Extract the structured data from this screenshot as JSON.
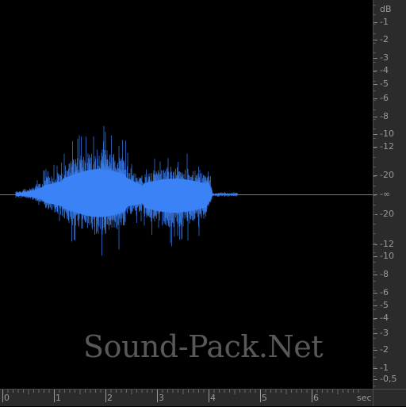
{
  "waveform": {
    "color": "#3b82f6",
    "background": "#000000"
  },
  "db_scale": {
    "unit": "dB",
    "labels": [
      "-1",
      "-2",
      "-3",
      "-4",
      "-5",
      "-6",
      "-8",
      "-10",
      "-12",
      "-20",
      "-∞",
      "-20",
      "-12",
      "-10",
      "-8",
      "-6",
      "-5",
      "-4",
      "-3",
      "-2",
      "-1",
      "-0,5"
    ]
  },
  "time_scale": {
    "unit": "sec",
    "labels": [
      "0",
      "1",
      "2",
      "3",
      "4",
      "5",
      "6"
    ]
  },
  "watermark": {
    "text": "Sound-Pack.Net",
    "color": "#585858"
  },
  "colors": {
    "ruler_bg": "#2b2b2b",
    "ruler_text": "#9a9a9a"
  }
}
